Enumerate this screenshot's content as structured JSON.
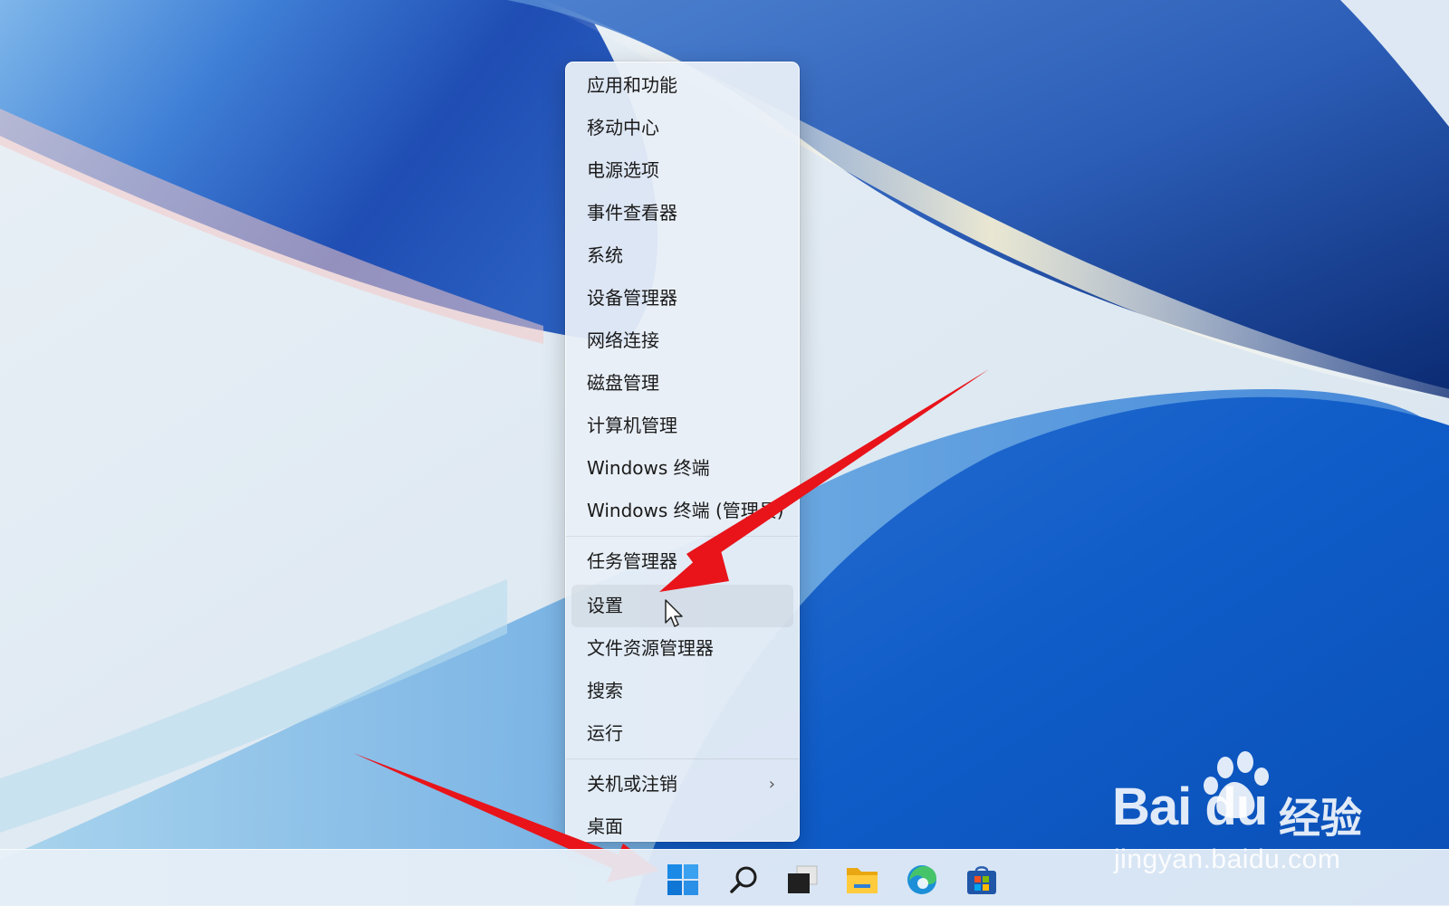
{
  "context_menu": {
    "items_group1": [
      {
        "label": "应用和功能"
      },
      {
        "label": "移动中心"
      },
      {
        "label": "电源选项"
      },
      {
        "label": "事件查看器"
      },
      {
        "label": "系统"
      },
      {
        "label": "设备管理器"
      },
      {
        "label": "网络连接"
      },
      {
        "label": "磁盘管理"
      },
      {
        "label": "计算机管理"
      },
      {
        "label": "Windows 终端"
      },
      {
        "label": "Windows 终端 (管理员)"
      }
    ],
    "items_group2": [
      {
        "label": "任务管理器"
      },
      {
        "label": "设置"
      },
      {
        "label": "文件资源管理器"
      },
      {
        "label": "搜索"
      },
      {
        "label": "运行"
      }
    ],
    "items_group3": [
      {
        "label": "关机或注销",
        "has_submenu": true
      },
      {
        "label": "桌面"
      }
    ],
    "hovered_item": "设置"
  },
  "taskbar": {
    "icons": [
      "start-windows-icon",
      "search-icon",
      "task-view-icon",
      "file-explorer-icon",
      "edge-browser-icon",
      "microsoft-store-icon"
    ]
  },
  "watermark": {
    "logo": "Bai du",
    "chinese": "经验",
    "url": "jingyan.baidu.com"
  },
  "annotation": {
    "arrow_color": "#e8141a"
  }
}
